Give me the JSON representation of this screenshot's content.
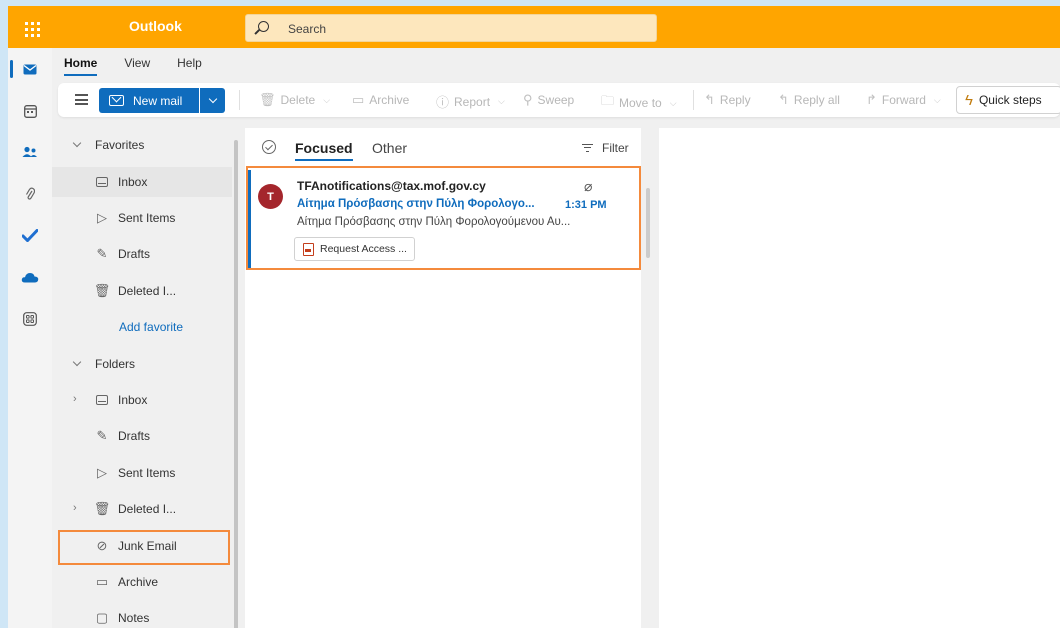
{
  "app": {
    "title": "Outlook"
  },
  "search": {
    "placeholder": "Search"
  },
  "menu_tabs": [
    "Home",
    "View",
    "Help"
  ],
  "ribbon": {
    "new_mail": "New mail",
    "delete": "Delete",
    "archive": "Archive",
    "report": "Report",
    "sweep": "Sweep",
    "move_to": "Move to",
    "reply": "Reply",
    "reply_all": "Reply all",
    "forward": "Forward",
    "quick_steps": "Quick steps"
  },
  "folders": {
    "favorites_header": "Favorites",
    "favorites": [
      {
        "label": "Inbox",
        "icon": "inbox-icon"
      },
      {
        "label": "Sent Items",
        "icon": "send-icon"
      },
      {
        "label": "Drafts",
        "icon": "pencil-icon"
      },
      {
        "label": "Deleted I...",
        "icon": "trash-icon"
      }
    ],
    "add_favorite": "Add favorite",
    "folders_header": "Folders",
    "items": [
      {
        "label": "Inbox",
        "icon": "inbox-icon"
      },
      {
        "label": "Drafts",
        "icon": "pencil-icon"
      },
      {
        "label": "Sent Items",
        "icon": "send-icon"
      },
      {
        "label": "Deleted I...",
        "icon": "trash-icon"
      },
      {
        "label": "Junk Email",
        "icon": "junk-icon"
      },
      {
        "label": "Archive",
        "icon": "archive-icon"
      },
      {
        "label": "Notes",
        "icon": "note-icon"
      }
    ]
  },
  "message_list": {
    "tab_focused": "Focused",
    "tab_other": "Other",
    "filter": "Filter",
    "messages": [
      {
        "avatar_initial": "T",
        "from": "TFAnotifications@tax.mof.gov.cy",
        "subject": "Αίτημα Πρόσβασης στην Πύλη Φορολογο...",
        "time": "1:31 PM",
        "preview": "Αίτημα Πρόσβασης στην Πύλη Φορολογούμενου Αυ...",
        "attachment": "Request Access ..."
      }
    ]
  },
  "colors": {
    "brand": "#ffa500",
    "accent": "#0f6cbd",
    "highlight": "#f48a3c",
    "avatar": "#a4262c"
  }
}
